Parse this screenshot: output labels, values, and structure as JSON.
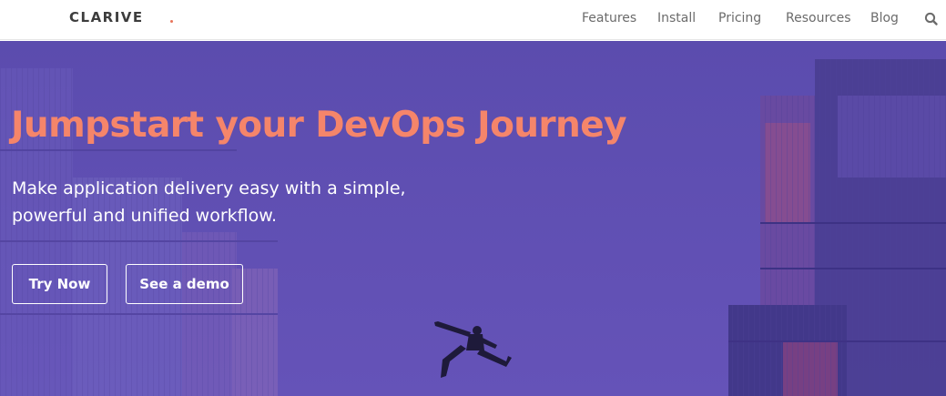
{
  "brand": {
    "logo_text": "CLARIVE",
    "accent": "#e8735a"
  },
  "nav": {
    "items": [
      {
        "label": "Features"
      },
      {
        "label": "Install"
      },
      {
        "label": "Pricing"
      },
      {
        "label": "Resources"
      },
      {
        "label": "Blog"
      }
    ],
    "search_icon": "search-icon"
  },
  "hero": {
    "headline": "Jumpstart your DevOps Journey",
    "subline_1": "Make application delivery easy with a simple,",
    "subline_2": "powerful and unified workflow.",
    "buttons": {
      "try_now": "Try Now",
      "see_demo": "See a demo"
    },
    "colors": {
      "background": "#5e4fb0",
      "headline": "#f5856a",
      "text": "#ffffff"
    }
  }
}
